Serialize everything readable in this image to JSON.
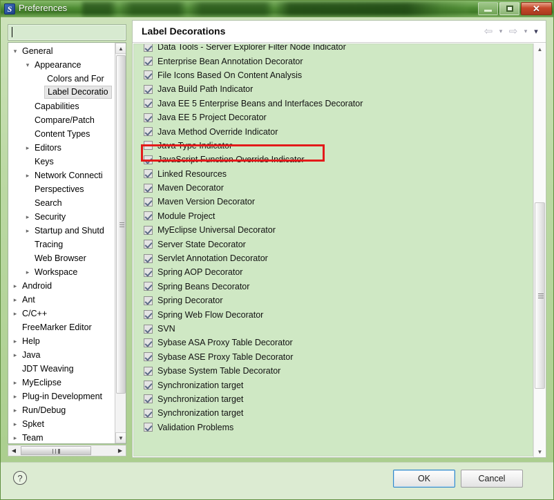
{
  "window": {
    "title": "Preferences",
    "icon": "eclipse-app-icon",
    "buttons": {
      "minimize": "minimize-icon",
      "maximize": "maximize-icon",
      "close": "✕"
    }
  },
  "filter": {
    "value": "",
    "placeholder": ""
  },
  "tree": {
    "items": [
      {
        "label": "General",
        "indent": 0,
        "arrow": "▾",
        "selected": false
      },
      {
        "label": "Appearance",
        "indent": 1,
        "arrow": "▾",
        "selected": false
      },
      {
        "label": "Colors and For",
        "indent": 2,
        "arrow": "",
        "selected": false
      },
      {
        "label": "Label Decoratio",
        "indent": 2,
        "arrow": "",
        "selected": true
      },
      {
        "label": "Capabilities",
        "indent": 1,
        "arrow": "",
        "selected": false
      },
      {
        "label": "Compare/Patch",
        "indent": 1,
        "arrow": "",
        "selected": false
      },
      {
        "label": "Content Types",
        "indent": 1,
        "arrow": "",
        "selected": false
      },
      {
        "label": "Editors",
        "indent": 1,
        "arrow": "▸",
        "selected": false
      },
      {
        "label": "Keys",
        "indent": 1,
        "arrow": "",
        "selected": false
      },
      {
        "label": "Network Connecti",
        "indent": 1,
        "arrow": "▸",
        "selected": false
      },
      {
        "label": "Perspectives",
        "indent": 1,
        "arrow": "",
        "selected": false
      },
      {
        "label": "Search",
        "indent": 1,
        "arrow": "",
        "selected": false
      },
      {
        "label": "Security",
        "indent": 1,
        "arrow": "▸",
        "selected": false
      },
      {
        "label": "Startup and Shutd",
        "indent": 1,
        "arrow": "▸",
        "selected": false
      },
      {
        "label": "Tracing",
        "indent": 1,
        "arrow": "",
        "selected": false
      },
      {
        "label": "Web Browser",
        "indent": 1,
        "arrow": "",
        "selected": false
      },
      {
        "label": "Workspace",
        "indent": 1,
        "arrow": "▸",
        "selected": false
      },
      {
        "label": "Android",
        "indent": 0,
        "arrow": "▸",
        "selected": false
      },
      {
        "label": "Ant",
        "indent": 0,
        "arrow": "▸",
        "selected": false
      },
      {
        "label": "C/C++",
        "indent": 0,
        "arrow": "▸",
        "selected": false
      },
      {
        "label": "FreeMarker Editor",
        "indent": 0,
        "arrow": "",
        "selected": false
      },
      {
        "label": "Help",
        "indent": 0,
        "arrow": "▸",
        "selected": false
      },
      {
        "label": "Java",
        "indent": 0,
        "arrow": "▸",
        "selected": false
      },
      {
        "label": "JDT Weaving",
        "indent": 0,
        "arrow": "",
        "selected": false
      },
      {
        "label": "MyEclipse",
        "indent": 0,
        "arrow": "▸",
        "selected": false
      },
      {
        "label": "Plug-in Development",
        "indent": 0,
        "arrow": "▸",
        "selected": false
      },
      {
        "label": "Run/Debug",
        "indent": 0,
        "arrow": "▸",
        "selected": false
      },
      {
        "label": "Spket",
        "indent": 0,
        "arrow": "▸",
        "selected": false
      },
      {
        "label": "Team",
        "indent": 0,
        "arrow": "▸",
        "selected": false
      }
    ]
  },
  "content": {
    "title": "Label Decorations",
    "nav": {
      "back": "⇦",
      "back_menu": "▾",
      "forward": "⇨",
      "forward_menu": "▾",
      "view_menu": "▾"
    },
    "decorations": [
      {
        "label": "Data Tools - Server Explorer Filter Node Indicator",
        "checked": true,
        "highlighted": false
      },
      {
        "label": "Enterprise Bean Annotation Decorator",
        "checked": true,
        "highlighted": false
      },
      {
        "label": "File Icons Based On Content Analysis",
        "checked": true,
        "highlighted": false
      },
      {
        "label": "Java Build Path Indicator",
        "checked": true,
        "highlighted": false
      },
      {
        "label": "Java EE 5 Enterprise Beans and Interfaces Decorator",
        "checked": true,
        "highlighted": false
      },
      {
        "label": "Java EE 5 Project Decorator",
        "checked": true,
        "highlighted": false
      },
      {
        "label": "Java Method Override Indicator",
        "checked": true,
        "highlighted": false
      },
      {
        "label": "Java Type Indicator",
        "checked": false,
        "highlighted": true
      },
      {
        "label": "JavaScript Function Override Indicator",
        "checked": true,
        "highlighted": false
      },
      {
        "label": "Linked Resources",
        "checked": true,
        "highlighted": false
      },
      {
        "label": "Maven Decorator",
        "checked": true,
        "highlighted": false
      },
      {
        "label": "Maven Version Decorator",
        "checked": true,
        "highlighted": false
      },
      {
        "label": "Module Project",
        "checked": true,
        "highlighted": false
      },
      {
        "label": "MyEclipse Universal Decorator",
        "checked": true,
        "highlighted": false
      },
      {
        "label": "Server State Decorator",
        "checked": true,
        "highlighted": false
      },
      {
        "label": "Servlet Annotation Decorator",
        "checked": true,
        "highlighted": false
      },
      {
        "label": "Spring AOP Decorator",
        "checked": true,
        "highlighted": false
      },
      {
        "label": "Spring Beans Decorator",
        "checked": true,
        "highlighted": false
      },
      {
        "label": "Spring Decorator",
        "checked": true,
        "highlighted": false
      },
      {
        "label": "Spring Web Flow Decorator",
        "checked": true,
        "highlighted": false
      },
      {
        "label": "SVN",
        "checked": true,
        "highlighted": false
      },
      {
        "label": "Sybase ASA Proxy Table Decorator",
        "checked": true,
        "highlighted": false
      },
      {
        "label": "Sybase ASE Proxy Table Decorator",
        "checked": true,
        "highlighted": false
      },
      {
        "label": "Sybase System Table Decorator",
        "checked": true,
        "highlighted": false
      },
      {
        "label": "Synchronization target",
        "checked": true,
        "highlighted": false
      },
      {
        "label": "Synchronization target",
        "checked": true,
        "highlighted": false
      },
      {
        "label": "Synchronization target",
        "checked": true,
        "highlighted": false
      },
      {
        "label": "Validation Problems",
        "checked": true,
        "highlighted": false
      }
    ]
  },
  "footer": {
    "help": "?",
    "ok": "OK",
    "cancel": "Cancel"
  },
  "colors": {
    "annotation": "#e31a1a",
    "list_background": "#cfe8c4",
    "title_bar": "#4e8c33",
    "ok_focus": "#2f86c9"
  }
}
